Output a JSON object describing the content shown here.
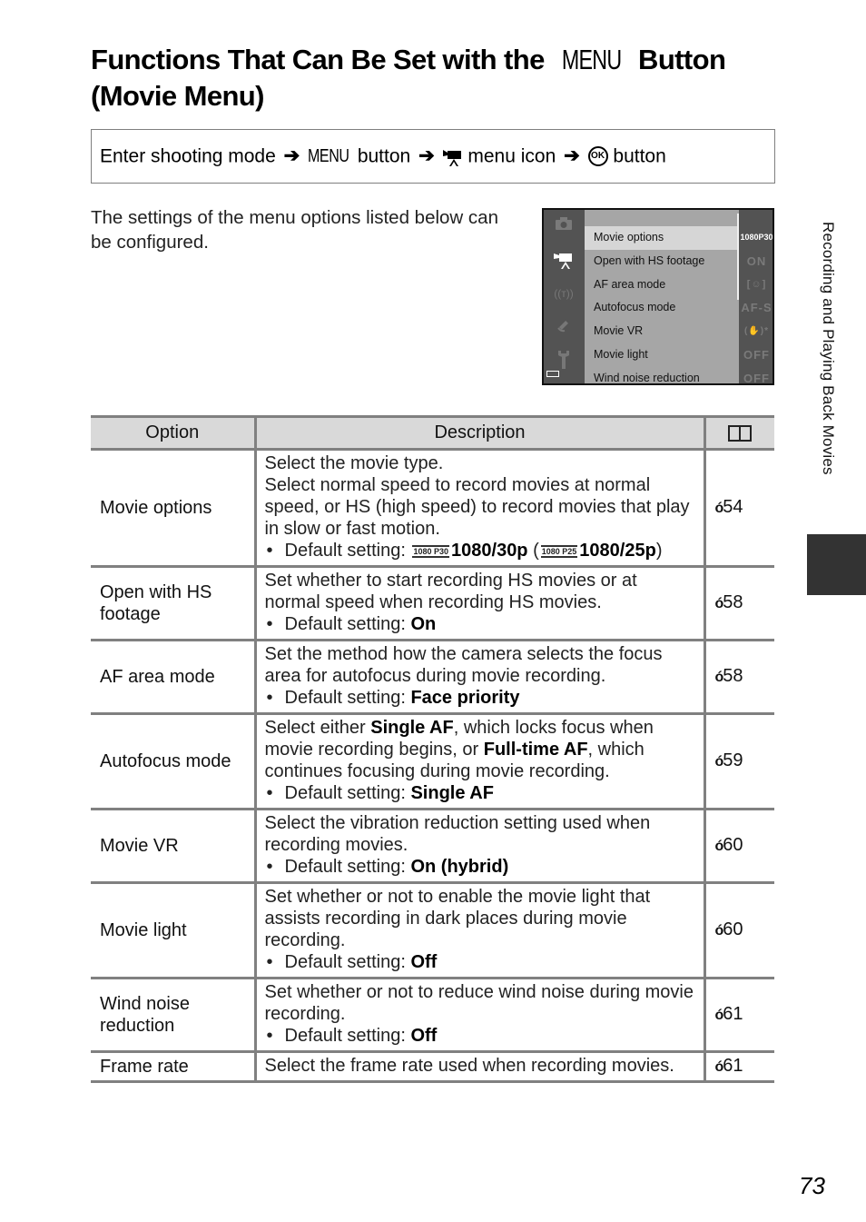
{
  "page": {
    "title_part1": "Functions That Can Be Set with the ",
    "title_menu_glyph": "MENU",
    "title_part2": " Button",
    "title_line2": "(Movie Menu)",
    "page_number": "73",
    "side_tab": "Recording and Playing Back Movies"
  },
  "nav": {
    "step1": "Enter shooting mode",
    "arrow": "➔",
    "menu_word": "MENU",
    "step2": "button",
    "movie_icon": "movie-camera-icon",
    "step3": "menu icon",
    "ok_glyph": "OK",
    "step4": "button"
  },
  "intro": "The settings of the menu options listed below can be configured.",
  "camera_screen": {
    "sidebar_icons": [
      "camera-icon",
      "movie-camera-icon",
      "wireless-icon",
      "satellite-icon",
      "wrench-icon"
    ],
    "active_icon": "movie-camera-icon",
    "items": [
      {
        "label": "Movie options",
        "value": "1080P30",
        "selected": true
      },
      {
        "label": "Open with HS footage",
        "value": "ON",
        "selected": false
      },
      {
        "label": "AF area mode",
        "value": "[☺]",
        "selected": false
      },
      {
        "label": "Autofocus mode",
        "value": "AF-S",
        "selected": false
      },
      {
        "label": "Movie VR",
        "value": "(✋)*",
        "selected": false
      },
      {
        "label": "Movie light",
        "value": "OFF",
        "selected": false
      },
      {
        "label": "Wind noise reduction",
        "value": "OFF",
        "selected": false
      }
    ]
  },
  "table": {
    "headers": [
      "Option",
      "Description",
      "book-icon"
    ],
    "ref_prefix": "ó",
    "rows": [
      {
        "option": "Movie options",
        "desc_lines": [
          "Select the movie type.",
          "Select normal speed to record movies at normal speed, or HS (high speed) to record movies that play in slow or fast motion."
        ],
        "default_label": "Default setting: ",
        "default_icon1": "1080 P30",
        "default_value": "1080/30p",
        "default_icon2": "1080 P25",
        "default_value_alt": "1080/25p",
        "ref": "54"
      },
      {
        "option": "Open with HS footage",
        "desc_lines": [
          "Set whether to start recording HS movies or at normal speed when recording HS movies."
        ],
        "default_label": "Default setting: ",
        "default_value": "On",
        "ref": "58"
      },
      {
        "option": "AF area mode",
        "desc_lines": [
          "Set the method how the camera selects the focus area for autofocus during movie recording."
        ],
        "default_label": "Default setting: ",
        "default_value": "Face priority",
        "ref": "58"
      },
      {
        "option": "Autofocus mode",
        "desc_parts": [
          "Select either ",
          "Single AF",
          ", which locks focus when movie recording begins, or ",
          "Full-time AF",
          ", which continues focusing during movie recording."
        ],
        "default_label": "Default setting: ",
        "default_value": "Single AF",
        "ref": "59"
      },
      {
        "option": "Movie VR",
        "desc_lines": [
          "Select the vibration reduction setting used when recording movies."
        ],
        "default_label": "Default setting: ",
        "default_value": "On (hybrid)",
        "ref": "60"
      },
      {
        "option": "Movie light",
        "desc_lines": [
          "Set whether or not to enable the movie light that assists recording in dark places during movie recording."
        ],
        "default_label": "Default setting: ",
        "default_value": "Off",
        "ref": "60"
      },
      {
        "option": "Wind noise reduction",
        "desc_lines": [
          "Set whether or not to reduce wind noise during movie recording."
        ],
        "default_label": "Default setting: ",
        "default_value": "Off",
        "ref": "61"
      },
      {
        "option": "Frame rate",
        "desc_lines": [
          "Select the frame rate used when recording movies."
        ],
        "ref": "61"
      }
    ]
  }
}
